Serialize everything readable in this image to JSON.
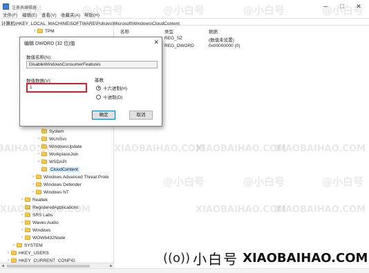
{
  "window": {
    "title": "注册表编辑器",
    "controls": {
      "minimize": "─",
      "maximize": "□",
      "close": "✕"
    }
  },
  "menu": [
    "文件(F)",
    "编辑(E)",
    "查看(V)",
    "收藏夹(A)",
    "帮助(H)"
  ],
  "address": "计算机\\HKEY_LOCAL_MACHINE\\SOFTWARE\\Policies\\Microsoft\\Windows\\CloudContent",
  "tree": {
    "top_item": "TPM",
    "items": [
      {
        "label": "System"
      },
      {
        "label": "WcmSvc"
      },
      {
        "label": "WindowsUpdate"
      },
      {
        "label": "WorkplaceJoin"
      },
      {
        "label": "WSDAPI"
      },
      {
        "label": "CloudContent"
      },
      {
        "label": "Windows Advanced Threat Prote"
      },
      {
        "label": "Windows Defender"
      },
      {
        "label": "Windows NT"
      },
      {
        "label": "Realtek"
      },
      {
        "label": "RegisteredApplications"
      },
      {
        "label": "SRS Labs"
      },
      {
        "label": "Waves Audio"
      },
      {
        "label": "Windows"
      },
      {
        "label": "WOW6432Node"
      },
      {
        "label": "SYSTEM"
      },
      {
        "label": "HKEY_USERS"
      },
      {
        "label": "HKEY_CURRENT_CONFIG"
      }
    ]
  },
  "list": {
    "headers": {
      "name": "名称",
      "type": "类型",
      "data": "数据"
    },
    "rows": [
      {
        "type": "REG_SZ",
        "data": "(数值未设置)"
      },
      {
        "type": "REG_DWORD",
        "data": "0x00000000 (0)"
      }
    ]
  },
  "dialog": {
    "title": "编辑 DWORD (32 位)值",
    "close": "✕",
    "name_label": "数值名称(N):",
    "name_value": "DisableWindowsConsumerFeatures",
    "data_label": "数值数据(V):",
    "data_value": "1",
    "base_label": "基数",
    "base_options": [
      {
        "label": "十六进制(H)",
        "checked": true
      },
      {
        "label": "十进制(D)",
        "checked": false
      }
    ],
    "ok": "确定",
    "cancel": "取消"
  },
  "watermark": {
    "handle": "@小白号",
    "site": "XIAOBAIHAO.COM",
    "brand_icon": "((o))",
    "brand_cn": "小白号",
    "brand_en": "XIAOBAIHAO.COM"
  },
  "colors": {
    "highlight_border": "#d0202a",
    "selection": "#cce8ff",
    "folder": "#f2c94c"
  }
}
